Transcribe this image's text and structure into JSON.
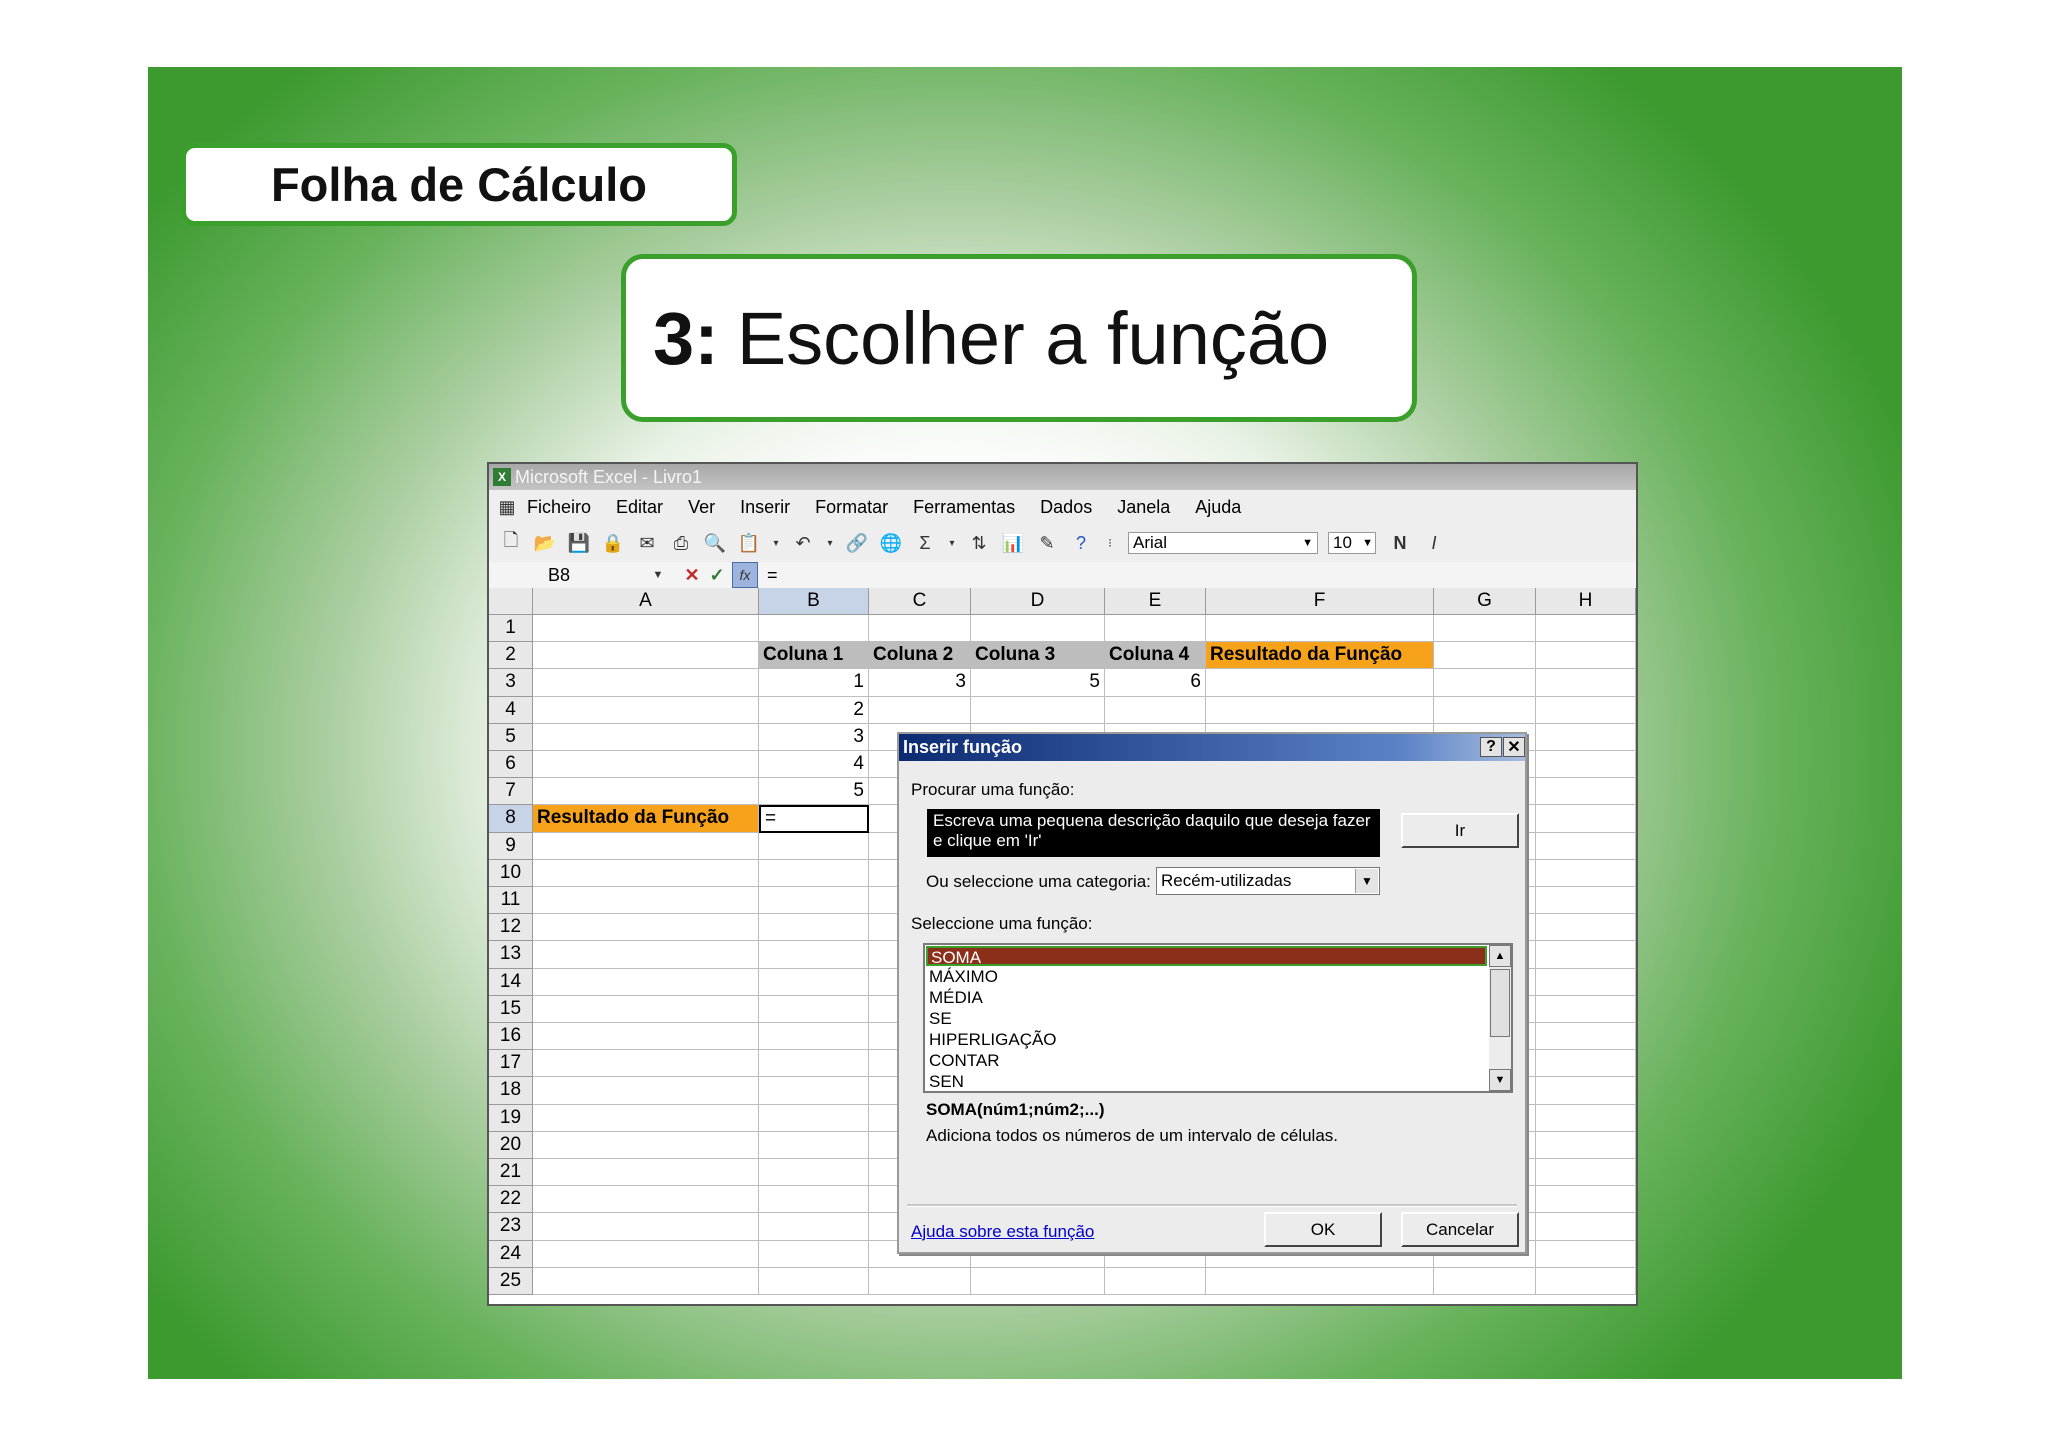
{
  "slide": {
    "title": "Folha de Cálculo",
    "step_number": "3:",
    "step_text": "Escolher a função"
  },
  "excel": {
    "window_title": "Microsoft Excel - Livro1",
    "menu": [
      "Ficheiro",
      "Editar",
      "Ver",
      "Inserir",
      "Formatar",
      "Ferramentas",
      "Dados",
      "Janela",
      "Ajuda"
    ],
    "toolbar": {
      "font_name": "Arial",
      "font_size": "10",
      "bold_label": "N",
      "italic_label": "I",
      "sum_label": "Σ"
    },
    "formula_bar": {
      "name_box": "B8",
      "formula": "="
    },
    "columns": [
      "A",
      "B",
      "C",
      "D",
      "E",
      "F",
      "G",
      "H"
    ],
    "rows": [
      "1",
      "2",
      "3",
      "4",
      "5",
      "6",
      "7",
      "8",
      "9",
      "10",
      "11",
      "12",
      "13",
      "14",
      "15",
      "16",
      "17",
      "18",
      "19",
      "20",
      "21",
      "22",
      "23",
      "24",
      "25"
    ],
    "cells": {
      "B2": "Coluna 1",
      "C2": "Coluna 2",
      "D2": "Coluna 3",
      "E2": "Coluna 4",
      "F2": "Resultado da Função",
      "B3": "1",
      "C3": "3",
      "D3": "5",
      "E3": "6",
      "B4": "2",
      "B5": "3",
      "B6": "4",
      "B7": "5",
      "A8": "Resultado da Função",
      "B8": "="
    },
    "colors": {
      "header_fill": "#bdbdbd",
      "highlight_fill": "#f7a21b"
    }
  },
  "dialog": {
    "title": "Inserir função",
    "help_btn": "?",
    "close_btn": "✕",
    "search_label": "Procurar uma função:",
    "search_value": "Escreva uma pequena descrição daquilo que deseja fazer e clique em 'Ir'",
    "go_button": "Ir",
    "category_label": "Ou seleccione uma categoria:",
    "category_value": "Recém-utilizadas",
    "function_label": "Seleccione uma função:",
    "functions": [
      "SOMA",
      "MÁXIMO",
      "MÉDIA",
      "SE",
      "HIPERLIGAÇÃO",
      "CONTAR",
      "SEN"
    ],
    "selected_function": "SOMA",
    "signature": "SOMA(núm1;núm2;...)",
    "description": "Adiciona todos os números de um intervalo de células.",
    "help_link": "Ajuda sobre esta função",
    "ok_button": "OK",
    "cancel_button": "Cancelar"
  }
}
